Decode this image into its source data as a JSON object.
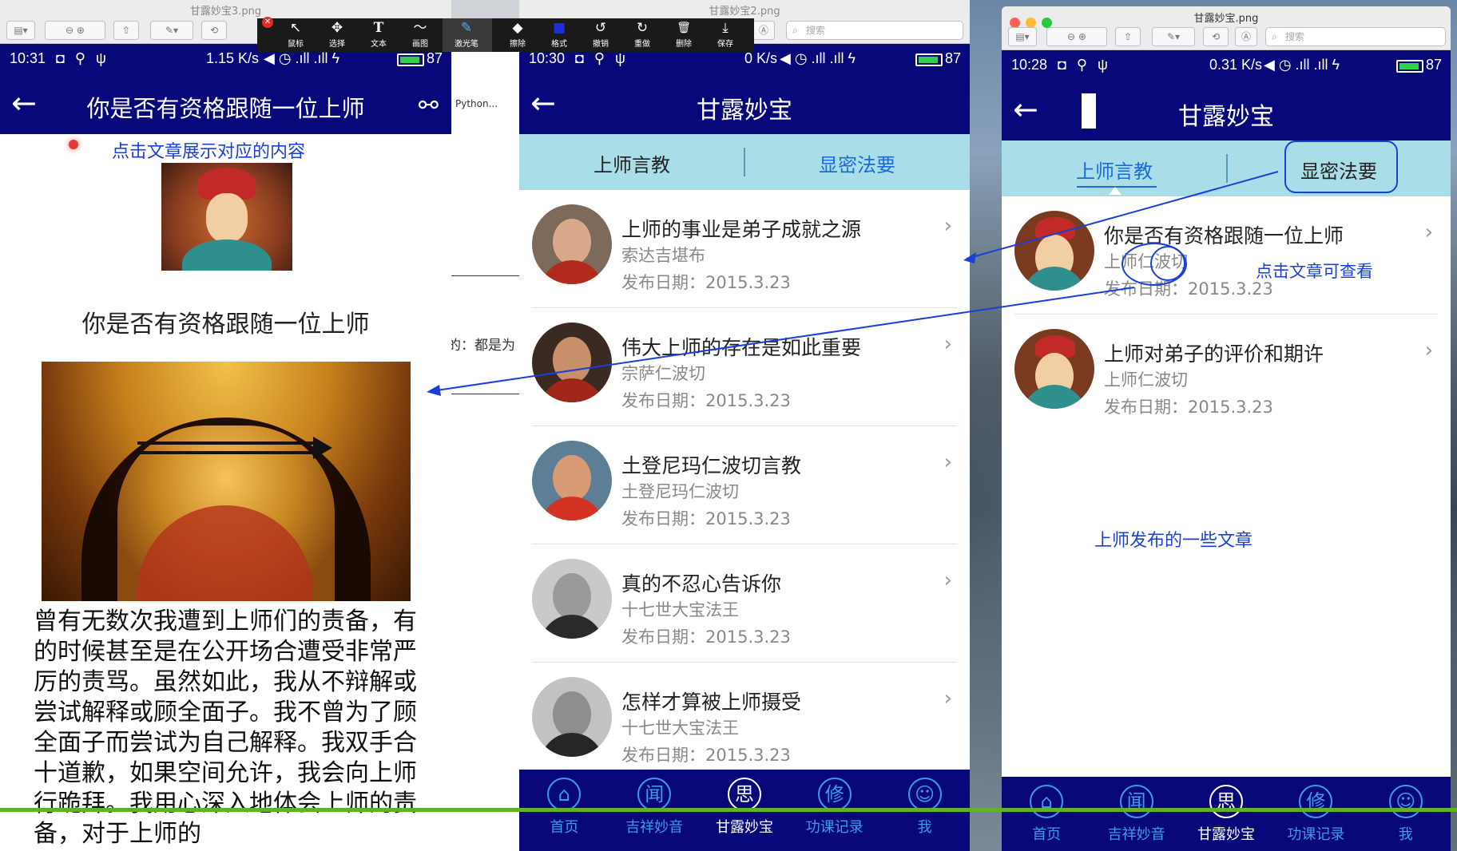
{
  "colors": {
    "nav_blue": "#08087a",
    "tab_blue": "#3d9ae8",
    "segment_bg": "#a9dde8",
    "annotation": "#1a3fd9",
    "divider_green": "#5fb22a"
  },
  "desktop": {
    "snippet_python": "Python...",
    "snippet_text": "的：都是为"
  },
  "toolbar": {
    "items": [
      {
        "icon": "pointer-icon",
        "glyph": "↖",
        "label": "鼠标"
      },
      {
        "icon": "move-icon",
        "glyph": "✥",
        "label": "选择"
      },
      {
        "icon": "text-icon",
        "glyph": "T",
        "label": "文本"
      },
      {
        "icon": "draw-icon",
        "glyph": "〜",
        "label": "画图"
      },
      {
        "icon": "laser-icon",
        "glyph": "✎",
        "label": "激光笔"
      },
      {
        "icon": "eraser-icon",
        "glyph": "◆",
        "label": "擦除"
      },
      {
        "icon": "format-icon",
        "glyph": "■",
        "label": "格式"
      },
      {
        "icon": "undo-icon",
        "glyph": "↺",
        "label": "撤销"
      },
      {
        "icon": "redo-icon",
        "glyph": "↻",
        "label": "重做"
      },
      {
        "icon": "delete-icon",
        "glyph": "🗑",
        "label": "删除"
      },
      {
        "icon": "save-icon",
        "glyph": "⤓",
        "label": "保存"
      }
    ]
  },
  "window1": {
    "title": "甘露妙宝3.png",
    "status": {
      "time": "10:31",
      "net": "1.15 K/s",
      "battery": "87"
    },
    "nav_title": "你是否有资格跟随一位上师",
    "annotation": "点击文章展示对应的内容",
    "article_heading": "你是否有资格跟随一位上师",
    "article_text": "曾有无数次我遭到上师们的责备，有的时候甚至是在公开场合遭受非常严厉的责骂。虽然如此，我从不辩解或尝试解释或顾全面子。我不曾为了顾全面子而尝试为自己解释。我双手合十道歉，如果空间允许，我会向上师行跪拜。我用心深入地体会上师的责备，对于上师的"
  },
  "window2": {
    "title": "甘露妙宝2.png",
    "search_placeholder": "搜索",
    "status": {
      "time": "10:30",
      "net": "0 K/s",
      "battery": "87"
    },
    "nav_title": "甘露妙宝",
    "segments": [
      "上师言教",
      "显密法要"
    ],
    "articles": [
      {
        "title": "上师的事业是弟子成就之源",
        "author": "索达吉堪布",
        "date": "发布日期：2015.3.23"
      },
      {
        "title": "伟大上师的存在是如此重要",
        "author": "宗萨仁波切",
        "date": "发布日期：2015.3.23"
      },
      {
        "title": "土登尼玛仁波切言教",
        "author": "土登尼玛仁波切",
        "date": "发布日期：2015.3.23"
      },
      {
        "title": "真的不忍心告诉你",
        "author": "十七世大宝法王",
        "date": "发布日期：2015.3.23"
      },
      {
        "title": "怎样才算被上师摄受",
        "author": "十七世大宝法王",
        "date": "发布日期：2015.3.23"
      }
    ],
    "tabs": [
      {
        "glyph": "⌂",
        "label": "首页"
      },
      {
        "glyph": "闻",
        "label": "吉祥妙音"
      },
      {
        "glyph": "思",
        "label": "甘露妙宝"
      },
      {
        "glyph": "修",
        "label": "功课记录"
      },
      {
        "glyph": "☺",
        "label": "我"
      }
    ]
  },
  "window3": {
    "title": "甘露妙宝.png",
    "search_placeholder": "搜索",
    "status": {
      "time": "10:28",
      "net": "0.31 K/s",
      "battery": "87"
    },
    "nav_title": "甘露妙宝",
    "segments": [
      "上师言教",
      "显密法要"
    ],
    "articles": [
      {
        "title": "你是否有资格跟随一位上师",
        "author": "上师仁波切",
        "date": "发布日期：2015.3.23"
      },
      {
        "title": "上师对弟子的评价和期许",
        "author": "上师仁波切",
        "date": "发布日期：2015.3.23"
      }
    ],
    "annotation_click": "点击文章可查看",
    "annotation_list": "上师发布的一些文章",
    "tabs": [
      {
        "glyph": "⌂",
        "label": "首页"
      },
      {
        "glyph": "闻",
        "label": "吉祥妙音"
      },
      {
        "glyph": "思",
        "label": "甘露妙宝"
      },
      {
        "glyph": "修",
        "label": "功课记录"
      },
      {
        "glyph": "☺",
        "label": "我"
      }
    ]
  }
}
